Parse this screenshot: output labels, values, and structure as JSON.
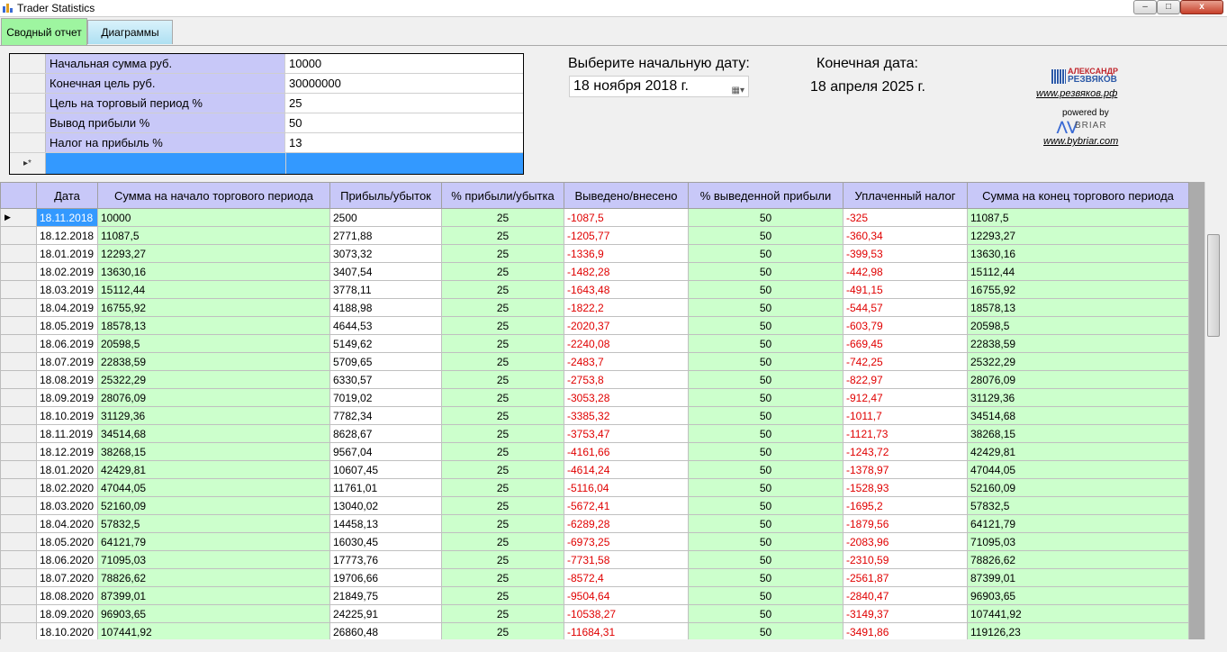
{
  "window": {
    "title": "Trader Statistics",
    "min": "–",
    "max": "□",
    "close": "x"
  },
  "tabs": [
    "Сводный отчет",
    "Диаграммы"
  ],
  "params": [
    {
      "label": "Начальная сумма руб.",
      "value": "10000"
    },
    {
      "label": "Конечная цель руб.",
      "value": "30000000"
    },
    {
      "label": "Цель на торговый период %",
      "value": "25"
    },
    {
      "label": "Вывод прибыли %",
      "value": "50"
    },
    {
      "label": "Налог на прибыль %",
      "value": "13"
    }
  ],
  "start_date": {
    "label": "Выберите начальную дату:",
    "value": "18   ноября   2018 г."
  },
  "end_date": {
    "label": "Конечная дата:",
    "value": "18 апреля 2025 г."
  },
  "branding": {
    "logo_top": "АЛЕКСАНДР",
    "logo_bottom": "РЕЗВЯКОВ",
    "link1": "www.резвяков.рф",
    "powered": "powered by",
    "briar": "BRIAR",
    "link2": "www.bybriar.com"
  },
  "table": {
    "columns": [
      "Дата",
      "Сумма на начало торгового периода",
      "Прибыль/убыток",
      "% прибыли/убытка",
      "Выведено/внесено",
      "% выведенной прибыли",
      "Уплаченный налог",
      "Сумма на конец торгового периода"
    ],
    "rows": [
      [
        "18.11.2018",
        "10000",
        "2500",
        "25",
        "-1087,5",
        "50",
        "-325",
        "11087,5"
      ],
      [
        "18.12.2018",
        "11087,5",
        "2771,88",
        "25",
        "-1205,77",
        "50",
        "-360,34",
        "12293,27"
      ],
      [
        "18.01.2019",
        "12293,27",
        "3073,32",
        "25",
        "-1336,9",
        "50",
        "-399,53",
        "13630,16"
      ],
      [
        "18.02.2019",
        "13630,16",
        "3407,54",
        "25",
        "-1482,28",
        "50",
        "-442,98",
        "15112,44"
      ],
      [
        "18.03.2019",
        "15112,44",
        "3778,11",
        "25",
        "-1643,48",
        "50",
        "-491,15",
        "16755,92"
      ],
      [
        "18.04.2019",
        "16755,92",
        "4188,98",
        "25",
        "-1822,2",
        "50",
        "-544,57",
        "18578,13"
      ],
      [
        "18.05.2019",
        "18578,13",
        "4644,53",
        "25",
        "-2020,37",
        "50",
        "-603,79",
        "20598,5"
      ],
      [
        "18.06.2019",
        "20598,5",
        "5149,62",
        "25",
        "-2240,08",
        "50",
        "-669,45",
        "22838,59"
      ],
      [
        "18.07.2019",
        "22838,59",
        "5709,65",
        "25",
        "-2483,7",
        "50",
        "-742,25",
        "25322,29"
      ],
      [
        "18.08.2019",
        "25322,29",
        "6330,57",
        "25",
        "-2753,8",
        "50",
        "-822,97",
        "28076,09"
      ],
      [
        "18.09.2019",
        "28076,09",
        "7019,02",
        "25",
        "-3053,28",
        "50",
        "-912,47",
        "31129,36"
      ],
      [
        "18.10.2019",
        "31129,36",
        "7782,34",
        "25",
        "-3385,32",
        "50",
        "-1011,7",
        "34514,68"
      ],
      [
        "18.11.2019",
        "34514,68",
        "8628,67",
        "25",
        "-3753,47",
        "50",
        "-1121,73",
        "38268,15"
      ],
      [
        "18.12.2019",
        "38268,15",
        "9567,04",
        "25",
        "-4161,66",
        "50",
        "-1243,72",
        "42429,81"
      ],
      [
        "18.01.2020",
        "42429,81",
        "10607,45",
        "25",
        "-4614,24",
        "50",
        "-1378,97",
        "47044,05"
      ],
      [
        "18.02.2020",
        "47044,05",
        "11761,01",
        "25",
        "-5116,04",
        "50",
        "-1528,93",
        "52160,09"
      ],
      [
        "18.03.2020",
        "52160,09",
        "13040,02",
        "25",
        "-5672,41",
        "50",
        "-1695,2",
        "57832,5"
      ],
      [
        "18.04.2020",
        "57832,5",
        "14458,13",
        "25",
        "-6289,28",
        "50",
        "-1879,56",
        "64121,79"
      ],
      [
        "18.05.2020",
        "64121,79",
        "16030,45",
        "25",
        "-6973,25",
        "50",
        "-2083,96",
        "71095,03"
      ],
      [
        "18.06.2020",
        "71095,03",
        "17773,76",
        "25",
        "-7731,58",
        "50",
        "-2310,59",
        "78826,62"
      ],
      [
        "18.07.2020",
        "78826,62",
        "19706,66",
        "25",
        "-8572,4",
        "50",
        "-2561,87",
        "87399,01"
      ],
      [
        "18.08.2020",
        "87399,01",
        "21849,75",
        "25",
        "-9504,64",
        "50",
        "-2840,47",
        "96903,65"
      ],
      [
        "18.09.2020",
        "96903,65",
        "24225,91",
        "25",
        "-10538,27",
        "50",
        "-3149,37",
        "107441,92"
      ],
      [
        "18.10.2020",
        "107441,92",
        "26860,48",
        "25",
        "-11684,31",
        "50",
        "-3491,86",
        "119126,23"
      ]
    ]
  }
}
